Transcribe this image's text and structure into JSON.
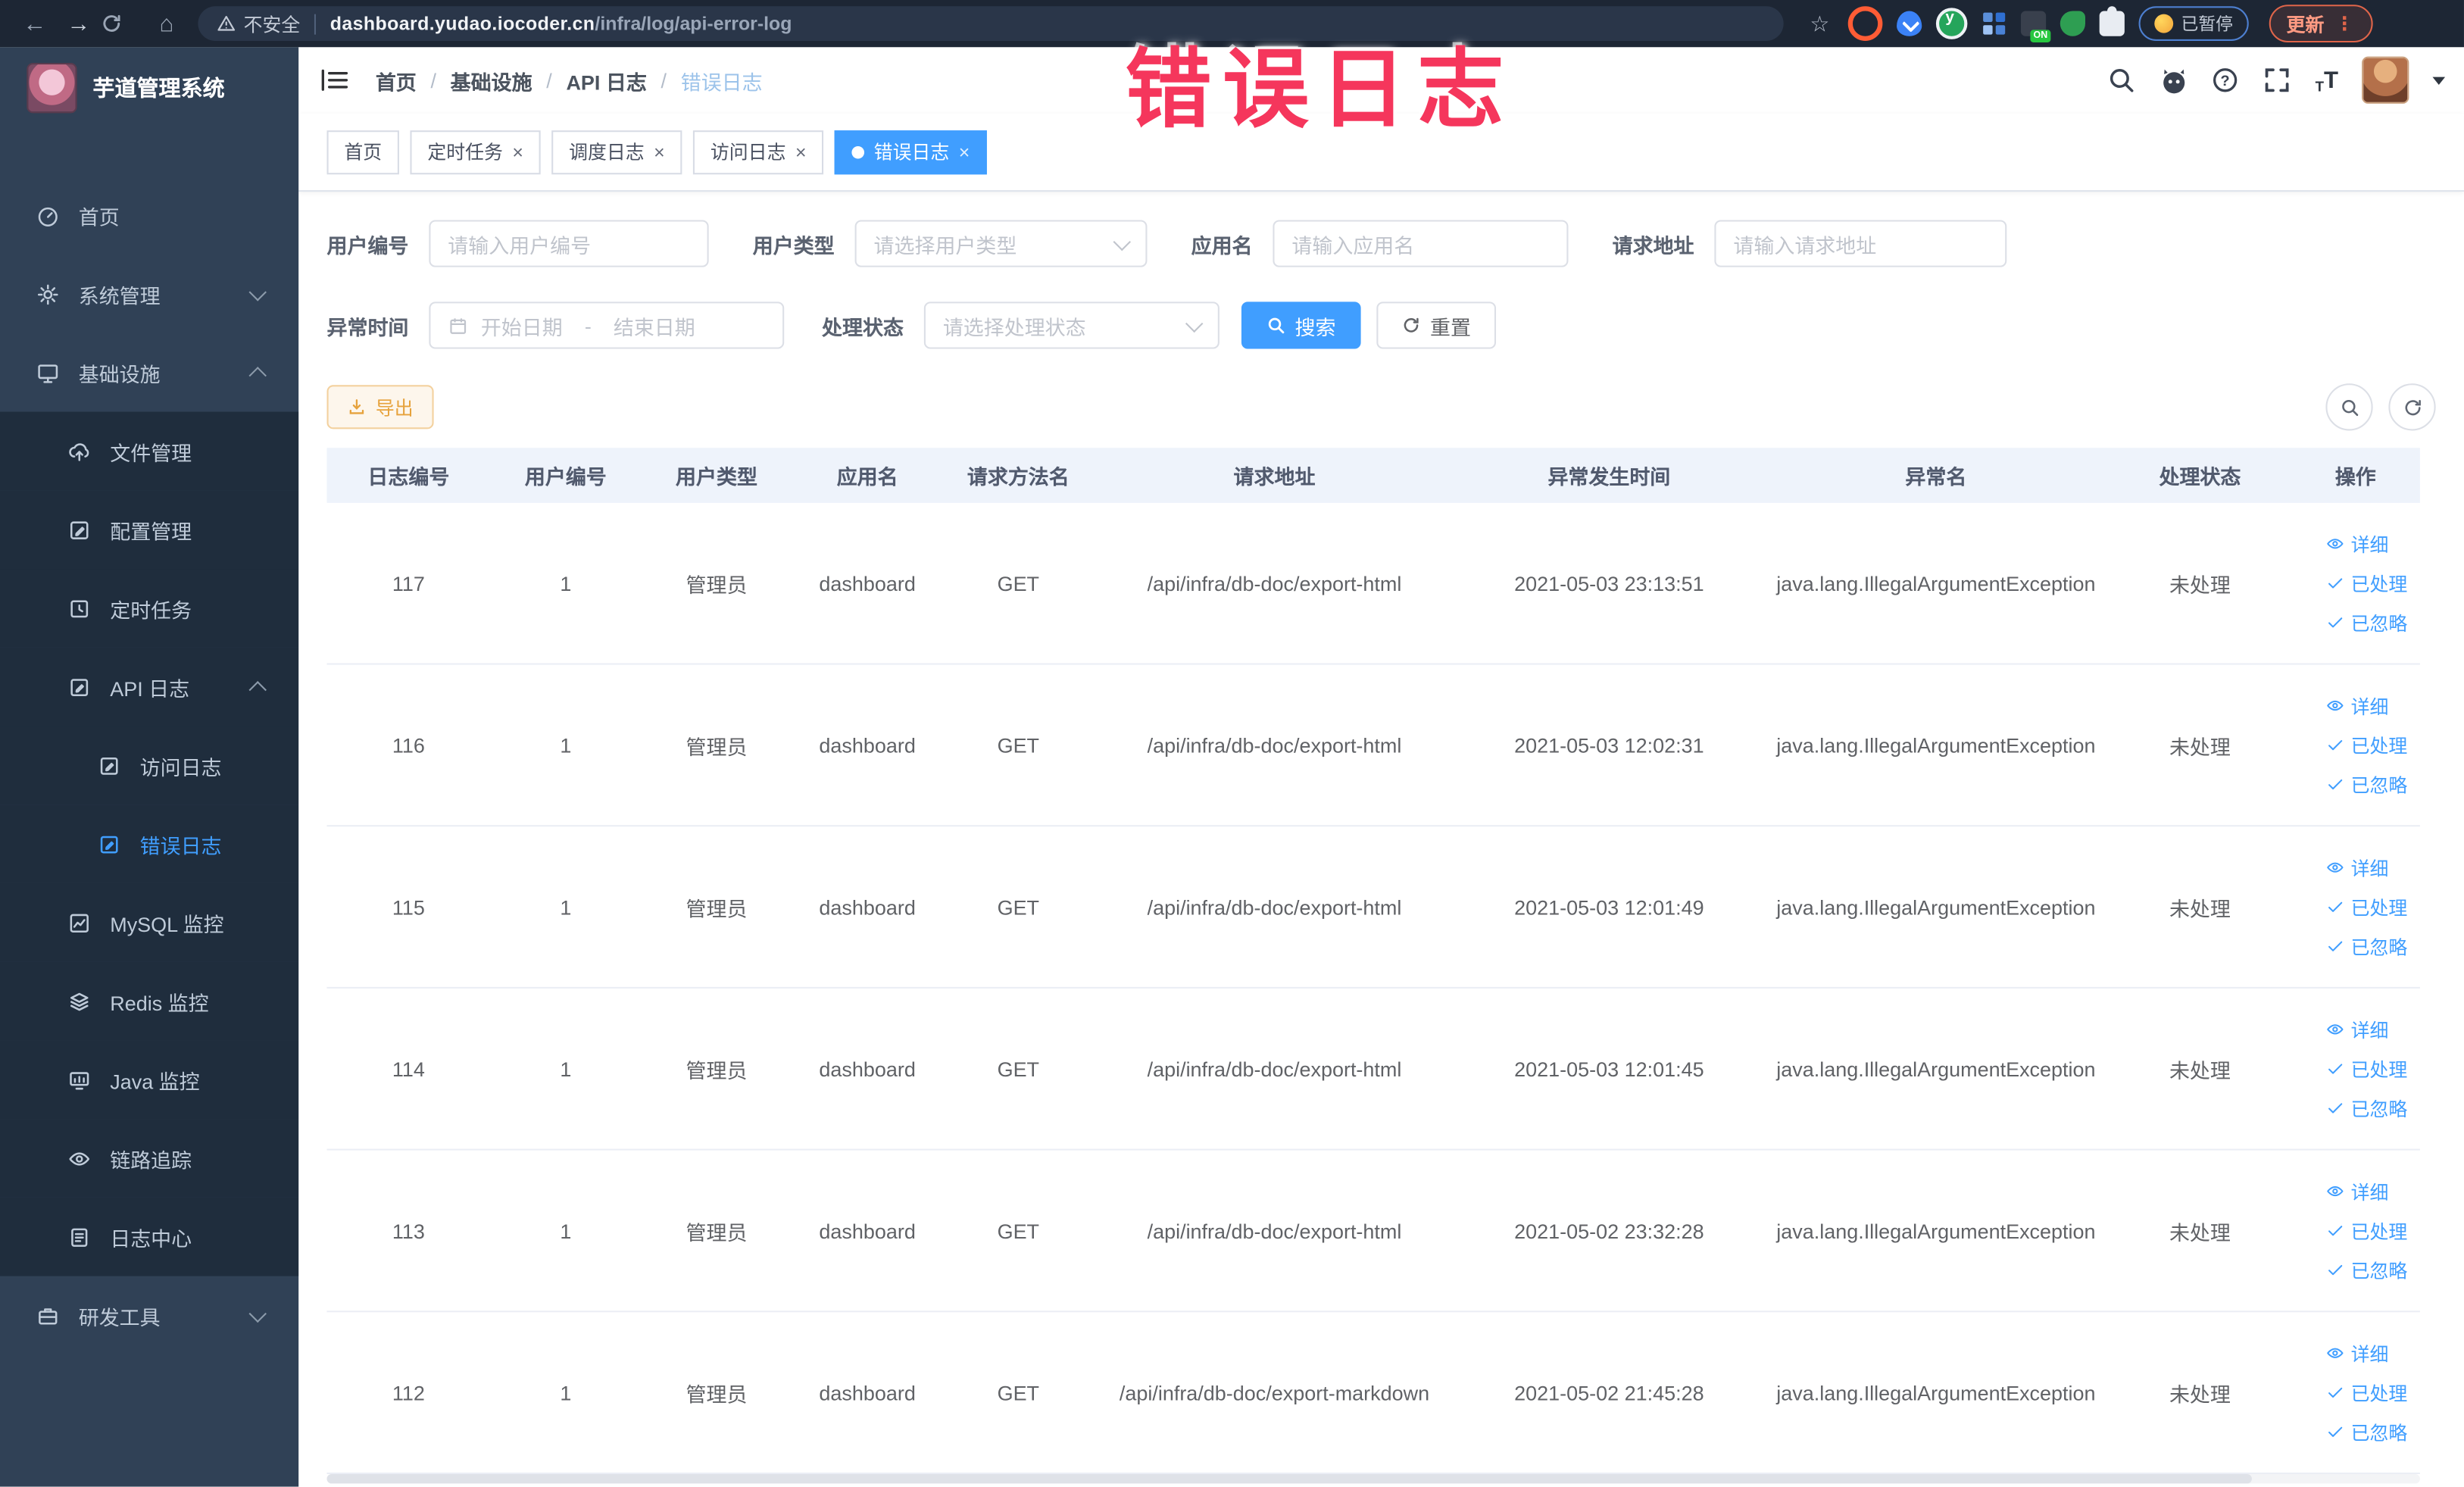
{
  "browser": {
    "security_label": "不安全",
    "url_domain": "dashboard.yudao.iocoder.cn",
    "url_path": "/infra/log/api-error-log",
    "paused_label": "已暂停",
    "update_label": "更新",
    "update_dots": "⋮",
    "star": "☆"
  },
  "annotation": {
    "text": "错误日志",
    "color": "#f5365c"
  },
  "app": {
    "title": "芋道管理系统"
  },
  "sidebar": {
    "items": [
      {
        "label": "首页",
        "icon": "gauge-icon",
        "level": 1,
        "sub": false,
        "chevron": ""
      },
      {
        "label": "系统管理",
        "icon": "gear-icon",
        "level": 1,
        "sub": false,
        "chevron": "down"
      },
      {
        "label": "基础设施",
        "icon": "monitor-icon",
        "level": 1,
        "sub": false,
        "chevron": "up"
      },
      {
        "label": "文件管理",
        "icon": "cloud-upload-icon",
        "level": 2,
        "sub": true,
        "chevron": ""
      },
      {
        "label": "配置管理",
        "icon": "edit-icon",
        "level": 2,
        "sub": true,
        "chevron": ""
      },
      {
        "label": "定时任务",
        "icon": "schedule-icon",
        "level": 2,
        "sub": true,
        "chevron": ""
      },
      {
        "label": "API 日志",
        "icon": "log-icon",
        "level": 2,
        "sub": true,
        "chevron": "up"
      },
      {
        "label": "访问日志",
        "icon": "log-icon",
        "level": 3,
        "sub": true,
        "chevron": ""
      },
      {
        "label": "错误日志",
        "icon": "log-icon",
        "level": 3,
        "sub": true,
        "chevron": "",
        "active": true
      },
      {
        "label": "MySQL 监控",
        "icon": "chart-icon",
        "level": 2,
        "sub": true,
        "chevron": ""
      },
      {
        "label": "Redis 监控",
        "icon": "layers-icon",
        "level": 2,
        "sub": true,
        "chevron": ""
      },
      {
        "label": "Java 监控",
        "icon": "screen-icon",
        "level": 2,
        "sub": true,
        "chevron": ""
      },
      {
        "label": "链路追踪",
        "icon": "eye-icon",
        "level": 2,
        "sub": true,
        "chevron": ""
      },
      {
        "label": "日志中心",
        "icon": "doc-icon",
        "level": 2,
        "sub": true,
        "chevron": ""
      },
      {
        "label": "研发工具",
        "icon": "briefcase-icon",
        "level": 1,
        "sub": false,
        "chevron": "down"
      }
    ]
  },
  "header": {
    "breadcrumb": [
      "首页",
      "基础设施",
      "API 日志",
      "错误日志"
    ]
  },
  "tabs": [
    {
      "label": "首页",
      "closable": false,
      "active": false
    },
    {
      "label": "定时任务",
      "closable": true,
      "active": false
    },
    {
      "label": "调度日志",
      "closable": true,
      "active": false
    },
    {
      "label": "访问日志",
      "closable": true,
      "active": false
    },
    {
      "label": "错误日志",
      "closable": true,
      "active": true
    }
  ],
  "filters": {
    "user_id": {
      "label": "用户编号",
      "placeholder": "请输入用户编号"
    },
    "user_type": {
      "label": "用户类型",
      "placeholder": "请选择用户类型"
    },
    "app_name": {
      "label": "应用名",
      "placeholder": "请输入应用名"
    },
    "request_url": {
      "label": "请求地址",
      "placeholder": "请输入请求地址"
    },
    "exception_time": {
      "label": "异常时间",
      "start_placeholder": "开始日期",
      "separator": "-",
      "end_placeholder": "结束日期"
    },
    "process_status": {
      "label": "处理状态",
      "placeholder": "请选择处理状态"
    },
    "search_label": "搜索",
    "reset_label": "重置"
  },
  "toolbar": {
    "export_label": "导出"
  },
  "table": {
    "columns": [
      "日志编号",
      "用户编号",
      "用户类型",
      "应用名",
      "请求方法名",
      "请求地址",
      "异常发生时间",
      "异常名",
      "处理状态",
      "操作"
    ],
    "actions": [
      "详细",
      "已处理",
      "已忽略"
    ],
    "rows": [
      {
        "id": "117",
        "user_id": "1",
        "user_type": "管理员",
        "app": "dashboard",
        "method": "GET",
        "url": "/api/infra/db-doc/export-html",
        "time": "2021-05-03 23:13:51",
        "exception": "java.lang.IllegalArgumentException",
        "status": "未处理"
      },
      {
        "id": "116",
        "user_id": "1",
        "user_type": "管理员",
        "app": "dashboard",
        "method": "GET",
        "url": "/api/infra/db-doc/export-html",
        "time": "2021-05-03 12:02:31",
        "exception": "java.lang.IllegalArgumentException",
        "status": "未处理"
      },
      {
        "id": "115",
        "user_id": "1",
        "user_type": "管理员",
        "app": "dashboard",
        "method": "GET",
        "url": "/api/infra/db-doc/export-html",
        "time": "2021-05-03 12:01:49",
        "exception": "java.lang.IllegalArgumentException",
        "status": "未处理"
      },
      {
        "id": "114",
        "user_id": "1",
        "user_type": "管理员",
        "app": "dashboard",
        "method": "GET",
        "url": "/api/infra/db-doc/export-html",
        "time": "2021-05-03 12:01:45",
        "exception": "java.lang.IllegalArgumentException",
        "status": "未处理"
      },
      {
        "id": "113",
        "user_id": "1",
        "user_type": "管理员",
        "app": "dashboard",
        "method": "GET",
        "url": "/api/infra/db-doc/export-html",
        "time": "2021-05-02 23:32:28",
        "exception": "java.lang.IllegalArgumentException",
        "status": "未处理"
      },
      {
        "id": "112",
        "user_id": "1",
        "user_type": "管理员",
        "app": "dashboard",
        "method": "GET",
        "url": "/api/infra/db-doc/export-markdown",
        "time": "2021-05-02 21:45:28",
        "exception": "java.lang.IllegalArgumentException",
        "status": "未处理"
      }
    ]
  },
  "colors": {
    "primary": "#409eff",
    "warning": "#e6a23c",
    "sidebar": "#304156",
    "sidebar_sub": "#1f2d3d"
  }
}
